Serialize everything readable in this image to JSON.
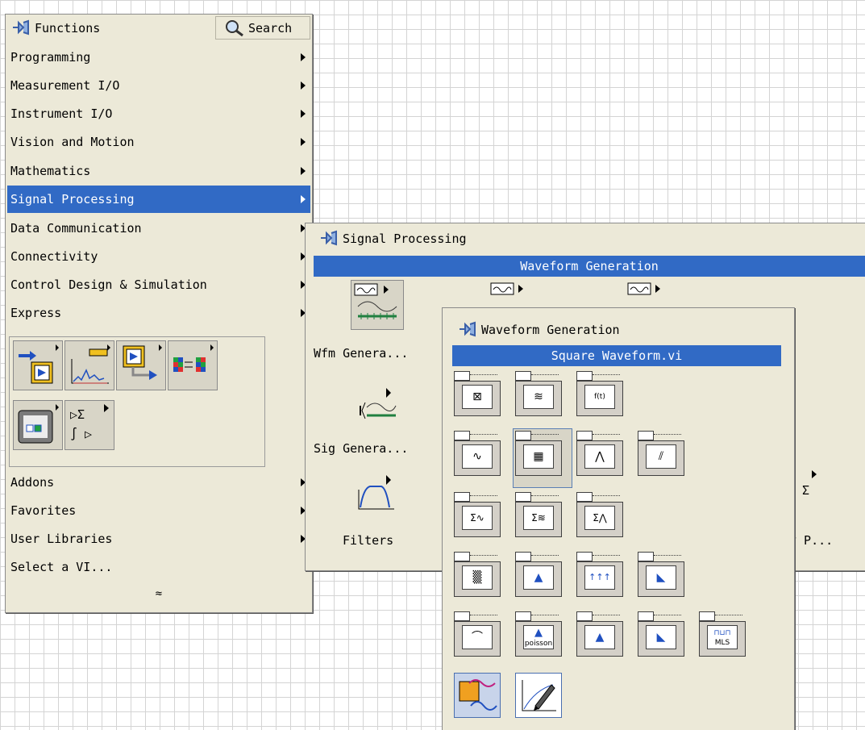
{
  "functions": {
    "title": "Functions",
    "search_label": "Search",
    "items": [
      {
        "label": "Programming",
        "submenu": true
      },
      {
        "label": "Measurement I/O",
        "submenu": true
      },
      {
        "label": "Instrument I/O",
        "submenu": true
      },
      {
        "label": "Vision and Motion",
        "submenu": true
      },
      {
        "label": "Mathematics",
        "submenu": true
      },
      {
        "label": "Signal Processing",
        "submenu": true,
        "selected": true
      },
      {
        "label": "Data Communication",
        "submenu": true
      },
      {
        "label": "Connectivity",
        "submenu": true
      },
      {
        "label": "Control Design & Simulation",
        "submenu": true
      },
      {
        "label": "Express",
        "submenu": true
      }
    ],
    "icon_tiles": [
      "input-express-icon",
      "analysis-express-icon",
      "output-express-icon",
      "signal-manipulation-express-icon",
      "execution-control-express-icon",
      "arithmetic-comparison-express-icon"
    ],
    "lower_items": [
      {
        "label": "Addons",
        "submenu": true
      },
      {
        "label": "Favorites",
        "submenu": true
      },
      {
        "label": "User Libraries",
        "submenu": true
      },
      {
        "label": "Select a VI...",
        "submenu": false
      }
    ],
    "collapse_glyph": "≈"
  },
  "signal_processing": {
    "title": "Signal Processing",
    "header": "Waveform Generation",
    "items": [
      {
        "caption": "Wfm Genera...",
        "icon": "waveform-generation-icon"
      },
      {
        "caption": "Sig Genera...",
        "icon": "signal-generation-icon"
      },
      {
        "caption": "Filters",
        "icon": "filters-icon"
      }
    ],
    "right_caption": "y P...",
    "right_glyph": "Σ"
  },
  "waveform_generation": {
    "title": "Waveform Generation",
    "header": "Square Waveform.vi",
    "rows": [
      [
        {
          "icon": "basic-function-generator-icon",
          "glyph": "⊠"
        },
        {
          "icon": "multi-tone-generator-icon",
          "glyph": "≋"
        },
        {
          "icon": "formula-waveform-icon",
          "glyph": "f(t)"
        }
      ],
      [
        {
          "icon": "sine-waveform-icon",
          "glyph": "∿"
        },
        {
          "icon": "square-waveform-icon",
          "glyph": "▦",
          "highlighted": true
        },
        {
          "icon": "triangle-waveform-icon",
          "glyph": "⋀"
        },
        {
          "icon": "sawtooth-waveform-icon",
          "glyph": "⫽"
        }
      ],
      [
        {
          "icon": "basic-multitone-icon",
          "glyph": "Σ∿"
        },
        {
          "icon": "multitone-amplitude-icon",
          "glyph": "Σ≋"
        },
        {
          "icon": "multitone-amplitude-phase-icon",
          "glyph": "Σ⋀"
        }
      ],
      [
        {
          "icon": "uniform-white-noise-icon",
          "glyph": "▒"
        },
        {
          "icon": "gaussian-white-noise-icon",
          "glyph": "▲"
        },
        {
          "icon": "periodic-random-noise-icon",
          "glyph": "↑↑↑"
        },
        {
          "icon": "inverse-f-noise-icon",
          "glyph": "◣"
        }
      ],
      [
        {
          "icon": "gamma-noise-icon",
          "glyph": "⌒"
        },
        {
          "icon": "poisson-noise-icon",
          "glyph": "▲"
        },
        {
          "icon": "binomial-noise-icon",
          "glyph": "▲"
        },
        {
          "icon": "bernoulli-noise-icon",
          "glyph": "◣"
        },
        {
          "icon": "mls-sequence-icon",
          "glyph": "⊓⊔"
        }
      ],
      [
        {
          "icon": "simulate-signal-express-icon",
          "glyph": "∿",
          "big": true
        },
        {
          "icon": "create-waveform-icon",
          "glyph": "✎",
          "big": true
        }
      ]
    ],
    "text_labels": {
      "formula": "f(t)",
      "poisson": "poisson",
      "mls": "MLS"
    }
  }
}
